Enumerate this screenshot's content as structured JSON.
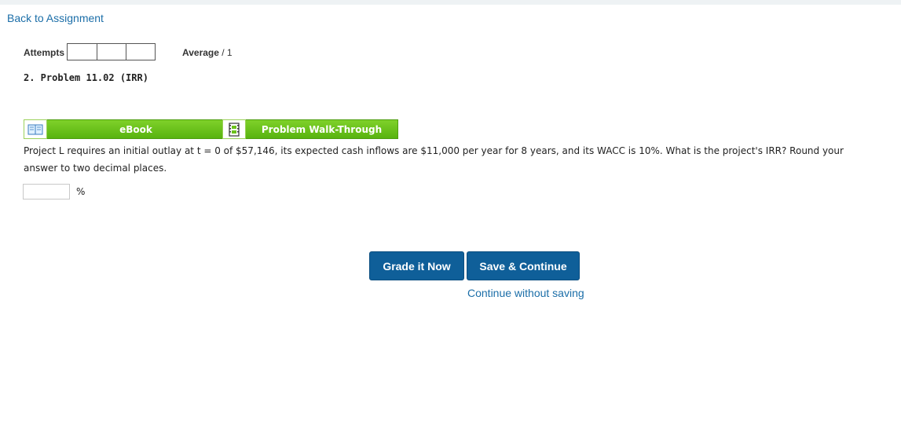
{
  "nav": {
    "back_label": "Back to Assignment"
  },
  "attempts": {
    "label": "Attempts",
    "boxes": [
      "",
      "",
      ""
    ]
  },
  "average": {
    "label": "Average",
    "value": "/ 1"
  },
  "problem": {
    "title": "2. Problem 11.02 (IRR)",
    "question": "Project L requires an initial outlay at t = 0 of $57,146, its expected cash inflows are $11,000 per year for 8 years, and its WACC is 10%. What is the project's IRR? Round your answer to two decimal places.",
    "answer_value": "",
    "answer_unit": "%"
  },
  "resources": {
    "ebook_label": "eBook",
    "walkthrough_label": "Problem Walk-Through"
  },
  "actions": {
    "grade_label": "Grade it Now",
    "save_label": "Save & Continue",
    "continue_label": "Continue without saving"
  },
  "colors": {
    "link": "#1b6ea8",
    "primary_button": "#0f5f99",
    "resource_green": "#6cc21c"
  }
}
